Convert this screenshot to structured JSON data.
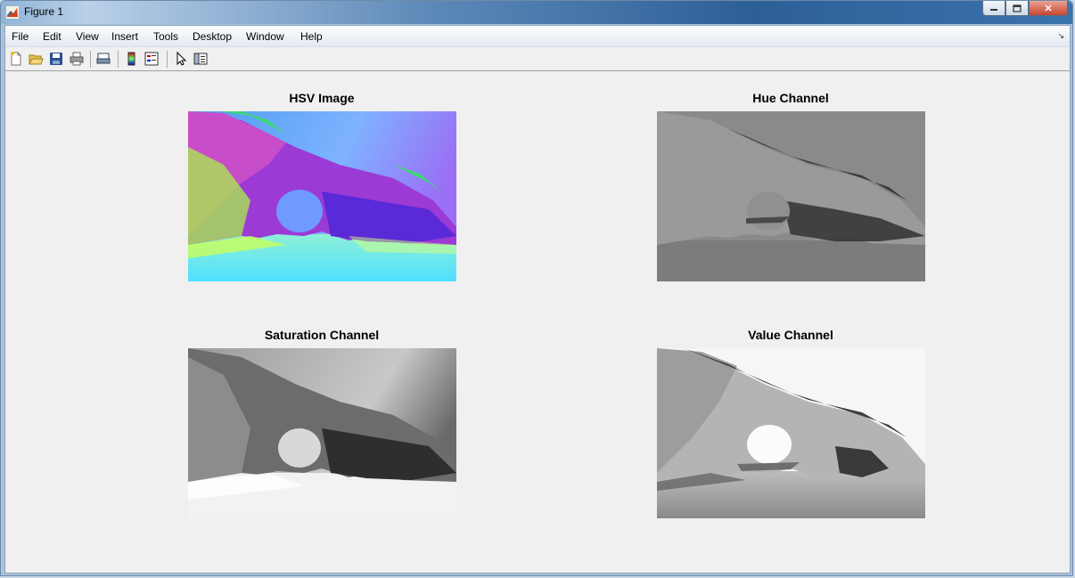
{
  "window": {
    "title": "Figure 1"
  },
  "menus": [
    "File",
    "Edit",
    "View",
    "Insert",
    "Tools",
    "Desktop",
    "Window",
    "Help"
  ],
  "toolbar_icons": [
    "new-figure-icon",
    "open-icon",
    "save-icon",
    "print-icon",
    "print-preview-icon",
    "colorbar-icon",
    "legend-icon",
    "select-pointer-icon",
    "property-editor-icon"
  ],
  "panels": [
    {
      "title": "HSV Image"
    },
    {
      "title": "Hue Channel"
    },
    {
      "title": "Saturation Channel"
    },
    {
      "title": "Value Channel"
    }
  ]
}
